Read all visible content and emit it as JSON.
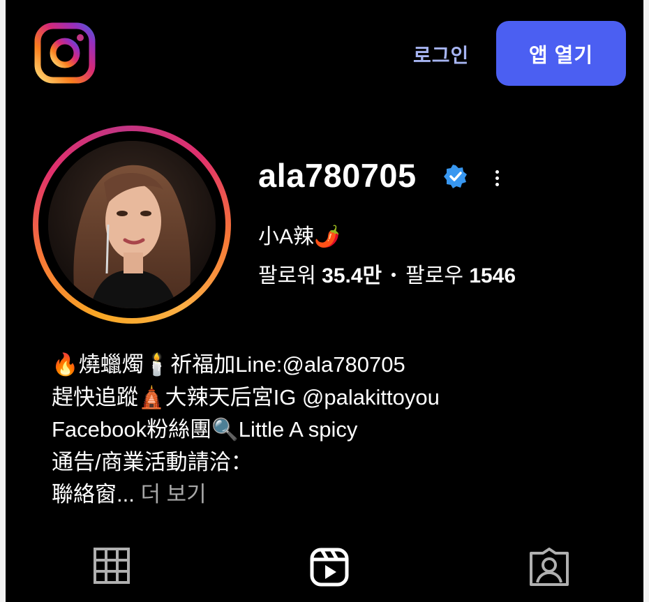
{
  "header": {
    "logo_icon": "instagram-logo-icon",
    "login_label": "로그인",
    "open_app_label": "앱 열기"
  },
  "profile": {
    "username": "ala780705",
    "verified": true,
    "display_name": "小A辣🌶️",
    "followers_label": "팔로워",
    "followers_count": "35.4만",
    "following_label": "팔로우",
    "following_count": "1546"
  },
  "bio": {
    "lines": [
      "🔥燒蠟燭🕯️祈福加Line:@ala780705",
      "趕快追蹤🛕大辣天后宮IG @palakittoyou",
      "Facebook粉絲團🔍Little A spicy",
      "通告/商業活動請洽：",
      "聯絡窗..."
    ],
    "see_more_label": "더 보기"
  },
  "tabs": [
    {
      "icon": "grid-icon"
    },
    {
      "icon": "reels-icon"
    },
    {
      "icon": "tagged-icon"
    }
  ],
  "colors": {
    "background": "#000000",
    "accent_button": "#4b5ff2",
    "login_link": "#a7b5f2",
    "verified_badge": "#3897f0",
    "secondary_text": "#a8a8a8"
  }
}
